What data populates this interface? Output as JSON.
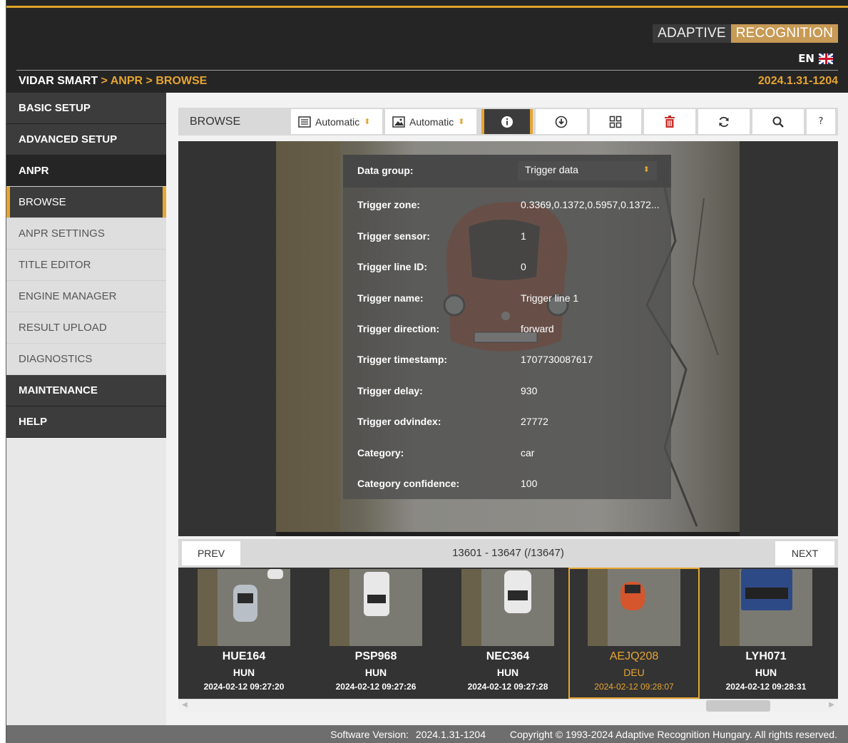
{
  "header": {
    "logo_part1": "ADAPTIVE",
    "logo_part2": "RECOGNITION",
    "lang": "EN",
    "breadcrumb": {
      "root": "VIDAR SMART",
      "sep1": " > ",
      "level1": "ANPR",
      "sep2": " > ",
      "level2": "BROWSE"
    },
    "version": "2024.1.31-1204"
  },
  "sidebar": {
    "items": [
      {
        "label": "BASIC SETUP"
      },
      {
        "label": "ADVANCED SETUP"
      },
      {
        "label": "ANPR"
      },
      {
        "label": "BROWSE"
      },
      {
        "label": "ANPR SETTINGS"
      },
      {
        "label": "TITLE EDITOR"
      },
      {
        "label": "ENGINE MANAGER"
      },
      {
        "label": "RESULT UPLOAD"
      },
      {
        "label": "DIAGNOSTICS"
      },
      {
        "label": "MAINTENANCE"
      },
      {
        "label": "HELP"
      }
    ]
  },
  "toolbar": {
    "title": "BROWSE",
    "select1": "Automatic",
    "select2": "Automatic",
    "help_label": "?"
  },
  "overlay": {
    "data_group_label": "Data group:",
    "data_group_value": "Trigger data",
    "rows": [
      {
        "key": "Trigger zone:",
        "value": "0.3369,0.1372,0.5957,0.1372..."
      },
      {
        "key": "Trigger sensor:",
        "value": "1"
      },
      {
        "key": "Trigger line ID:",
        "value": "0"
      },
      {
        "key": "Trigger name:",
        "value": "Trigger line 1"
      },
      {
        "key": "Trigger direction:",
        "value": "forward"
      },
      {
        "key": "Trigger timestamp:",
        "value": "1707730087617"
      },
      {
        "key": "Trigger delay:",
        "value": "930"
      },
      {
        "key": "Trigger odvindex:",
        "value": "27772"
      },
      {
        "key": "Category:",
        "value": "car"
      },
      {
        "key": "Category confidence:",
        "value": "100"
      }
    ]
  },
  "pager": {
    "prev": "PREV",
    "next": "NEXT",
    "info": "13601 - 13647 (/13647)"
  },
  "thumbnails": [
    {
      "plate": "HUE164",
      "country": "HUN",
      "timestamp": "2024-02-12 09:27:20",
      "car_color": "#b9bfc6"
    },
    {
      "plate": "PSP968",
      "country": "HUN",
      "timestamp": "2024-02-12 09:27:26",
      "car_color": "#e8e8e8"
    },
    {
      "plate": "NEC364",
      "country": "HUN",
      "timestamp": "2024-02-12 09:27:28",
      "car_color": "#e9e9e9"
    },
    {
      "plate": "AEJQ208",
      "country": "DEU",
      "timestamp": "2024-02-12 09:28:07",
      "car_color": "#d5552d"
    },
    {
      "plate": "LYH071",
      "country": "HUN",
      "timestamp": "2024-02-12 09:28:31",
      "car_color": "#2e4a86"
    }
  ],
  "footer": {
    "version_label": "Software Version:",
    "version_value": "2024.1.31-1204",
    "copyright": "Copyright © 1993-2024 Adaptive Recognition Hungary. All rights reserved."
  },
  "colors": {
    "accent": "#e6a531",
    "dark": "#252525"
  }
}
